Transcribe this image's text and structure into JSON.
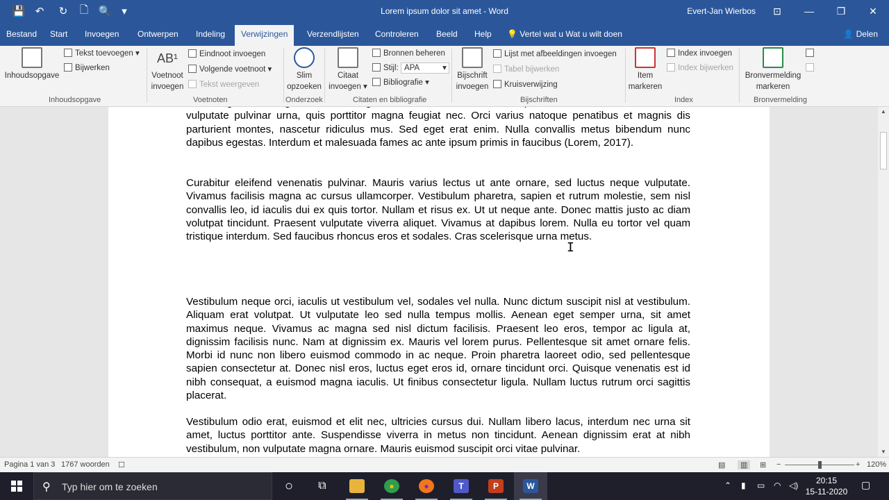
{
  "title_bar": {
    "doc_title": "Lorem ipsum dolor sit amet  -  Word",
    "user": "Evert-Jan Wierbos",
    "qat": [
      "save-icon",
      "undo-icon",
      "redo-icon",
      "new-doc-icon",
      "print-preview-icon",
      "customize-icon"
    ],
    "qat_glyphs": [
      "💾",
      "↶",
      "↻",
      "🗋",
      "🔍",
      "▾"
    ],
    "win_glyphs": {
      "ribbon_display": "⊡",
      "minimize": "—",
      "restore": "❐",
      "close": "✕"
    }
  },
  "tabs": [
    {
      "label": "Bestand"
    },
    {
      "label": "Start"
    },
    {
      "label": "Invoegen"
    },
    {
      "label": "Ontwerpen"
    },
    {
      "label": "Indeling"
    },
    {
      "label": "Verwijzingen",
      "active": true
    },
    {
      "label": "Verzendlijsten"
    },
    {
      "label": "Controleren"
    },
    {
      "label": "Beeld"
    },
    {
      "label": "Help"
    }
  ],
  "tell_me": "Wat u wilt doen",
  "tell_me_icon": "💡",
  "tell_me_prefix": "Vertel wat u ",
  "share": "Delen",
  "share_icon": "👤",
  "ribbon": {
    "toc": {
      "big": "Inhoudsopgave",
      "add_text": "Tekst toevoegen",
      "update": "Bijwerken",
      "group": "Inhoudsopgave"
    },
    "footnotes": {
      "big_line1": "Voetnoot",
      "big_line2": "invoegen",
      "endnote": "Eindnoot invoegen",
      "next": "Volgende voetnoot",
      "show": "Tekst weergeven",
      "group": "Voetnoten",
      "ab_glyph": "AB¹"
    },
    "research": {
      "big_line1": "Slim",
      "big_line2": "opzoeken",
      "group": "Onderzoek"
    },
    "citations": {
      "big_line1": "Citaat",
      "big_line2": "invoegen",
      "manage": "Bronnen beheren",
      "style_label": "Stijl:",
      "style_value": "APA",
      "bibliography": "Bibliografie",
      "group": "Citaten en bibliografie"
    },
    "captions": {
      "big_line1": "Bijschrift",
      "big_line2": "invoegen",
      "table_figures": "Lijst met afbeeldingen invoegen",
      "update_table": "Tabel bijwerken",
      "cross_ref": "Kruisverwijzing",
      "group": "Bijschriften"
    },
    "index": {
      "big_line1": "Item",
      "big_line2": "markeren",
      "insert": "Index invoegen",
      "update": "Index bijwerken",
      "group": "Index"
    },
    "toa": {
      "big_line1": "Bronvermelding",
      "big_line2": "markeren",
      "group": "Bronvermelding"
    }
  },
  "document": {
    "paragraphs": [
      "Sed congue tortor eget iaculis. Vel ligula massa, eleifend finibus. Aliquam viverra mauris lacus. Nullam vulputate pulvinar urna, quis porttitor magna feugiat nec. Orci varius natoque penatibus et magnis dis parturient montes, nascetur ridiculus mus. Sed eget erat enim. Nulla convallis metus bibendum nunc dapibus egestas. Interdum et malesuada fames ac ante ipsum primis in faucibus (Lorem, 2017).",
      "Curabitur eleifend venenatis pulvinar. Mauris varius lectus ut ante ornare, sed luctus neque vulputate. Vivamus facilisis magna ac cursus ullamcorper. Vestibulum pharetra, sapien et rutrum molestie, sem nisl convallis leo, id iaculis dui ex quis tortor. Nullam et risus ex. Ut ut neque ante. Donec mattis justo ac diam volutpat tincidunt. Praesent vulputate viverra aliquet. Vivamus at dapibus lorem. Nulla eu tortor vel quam tristique interdum. Sed faucibus rhoncus eros et sodales. Cras scelerisque urna metus.",
      "Vestibulum neque orci, iaculis ut vestibulum vel, sodales vel nulla. Nunc dictum suscipit nisl at vestibulum. Aliquam erat volutpat. Ut vulputate leo sed nulla tempus mollis. Aenean eget semper urna, sit amet maximus neque. Vivamus ac magna sed nisl dictum facilisis. Praesent leo eros, tempor ac ligula at, dignissim facilisis nunc. Nam at dignissim ex. Mauris vel lorem purus. Pellentesque sit amet ornare felis. Morbi id nunc non libero euismod commodo in ac neque. Proin pharetra laoreet odio, sed pellentesque sapien consectetur at. Donec nisl eros, luctus eget eros id, ornare tincidunt orci. Quisque venenatis est id nibh consequat, a euismod magna iaculis. Ut finibus consectetur ligula. Nullam luctus rutrum orci sagittis placerat.",
      "Vestibulum odio erat, euismod et elit nec, ultricies cursus dui. Nullam libero lacus, interdum nec urna sit amet, luctus porttitor ante. Suspendisse viverra in metus non tincidunt. Aenean dignissim erat at nibh vestibulum, non vulputate magna ornare. Mauris euismod suscipit orci vitae pulvinar."
    ],
    "ibeam_glyph": "I"
  },
  "status_bar": {
    "page": "Pagina 1 van 3",
    "words": "1767 woorden",
    "zoom": "120%",
    "zoom_minus": "−",
    "zoom_plus": "+"
  },
  "taskbar": {
    "search_placeholder": "Typ hier om te zoeken",
    "search_glyph": "⚲",
    "apps": [
      {
        "name": "cortana-icon",
        "glyph": "○",
        "color": "transparent"
      },
      {
        "name": "task-view-icon",
        "glyph": "⧉",
        "color": "transparent"
      },
      {
        "name": "file-explorer-icon",
        "glyph": "",
        "color": "#e8b43c"
      },
      {
        "name": "chrome-icon",
        "glyph": "●",
        "color": "#2f9d4d"
      },
      {
        "name": "firefox-icon",
        "glyph": "●",
        "color": "#f2761b"
      },
      {
        "name": "teams-icon",
        "glyph": "T",
        "color": "#5059c9"
      },
      {
        "name": "powerpoint-icon",
        "glyph": "P",
        "color": "#c43e1c"
      },
      {
        "name": "word-icon",
        "glyph": "W",
        "color": "#2b579a"
      }
    ],
    "time": "20:15",
    "date": "15-11-2020"
  }
}
